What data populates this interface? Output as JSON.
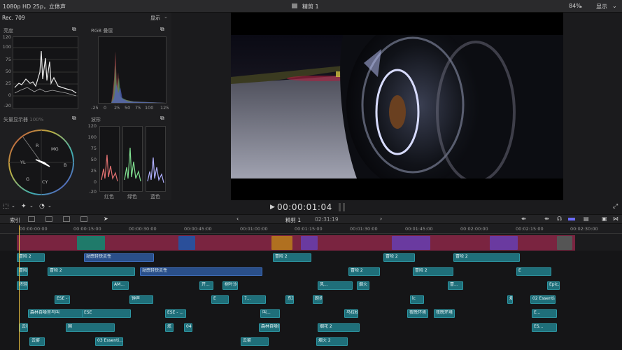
{
  "topbar": {
    "format": "1080p HD 25p，立体声",
    "title": "精剪 1",
    "zoom": "84%",
    "display": "显示"
  },
  "scopes": {
    "colorspace": "Rec. 709",
    "display": "显示",
    "luma": {
      "title": "亮度",
      "ticks": [
        "120",
        "100",
        "75",
        "50",
        "25",
        "0",
        "-20"
      ]
    },
    "rgb": {
      "title": "RGB 叠层",
      "ticks": [
        "-25",
        "0",
        "25",
        "50",
        "75",
        "100",
        "125"
      ]
    },
    "vector": {
      "title": "矢量显示器",
      "pct": "100%",
      "labels": [
        "R",
        "MG",
        "YL",
        "B",
        "G",
        "CY"
      ]
    },
    "wave": {
      "title": "波形",
      "ticks": [
        "120",
        "100",
        "75",
        "50",
        "25",
        "0",
        "-20"
      ],
      "channels": [
        "红色",
        "绿色",
        "蓝色"
      ]
    }
  },
  "viewer": {
    "timecode": "00:00:01:04"
  },
  "timeline": {
    "index": "索引",
    "project": "精剪 1",
    "duration": "02:31:19",
    "ruler": [
      "00:00:00:00",
      "00:00:15:00",
      "00:00:30:00",
      "00:00:45:00",
      "00:01:00:00",
      "00:01:15:00",
      "00:01:30:00",
      "00:01:45:00",
      "00:02:00:00",
      "00:02:15:00",
      "00:02:30:00"
    ],
    "labels": [
      "冒险 2",
      "动感轻快灵性",
      "冒险 2",
      "冒险 2",
      "冒险 2",
      "冒险 2",
      "冒险 2",
      "动感轻快灵性",
      "冒险 2",
      "冒险 2",
      "E",
      "冒险 2",
      "转轻旋",
      "AM...",
      "开...",
      "树叶沙沙",
      "风...",
      "烟火 3",
      "冒...",
      "Epic...",
      "ESE - Q...",
      "钟声",
      "E",
      "东开远",
      "7...",
      "跑步",
      "lc",
      "烟火 3",
      "02 Essential Ri...",
      "森林自噪音鸟叫",
      "ESE",
      "云雾",
      "ESE - ...",
      "叫...",
      "马拉松",
      "夜晚环境",
      "夜晚环境",
      "E...",
      "云雾",
      "国",
      "炫",
      "04 Ha...",
      "森林自噪音鸟叫",
      "烟花 2",
      "ES...",
      "云雾",
      "03 Essenti...",
      "云雾",
      "烟火 2"
    ]
  }
}
